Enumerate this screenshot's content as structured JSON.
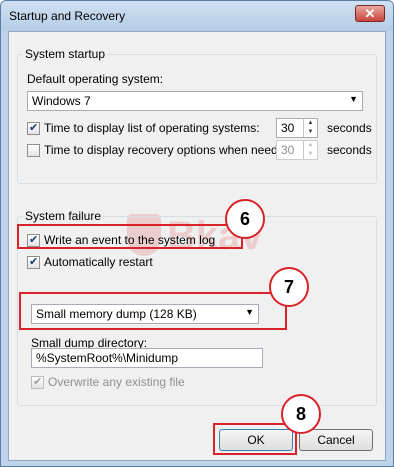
{
  "window": {
    "title": "Startup and Recovery",
    "close_label": "✕"
  },
  "system_startup": {
    "legend": "System startup",
    "default_os_label": "Default operating system:",
    "default_os_value": "Windows 7",
    "time_list": {
      "label": "Time to display list of operating systems:",
      "checked": true,
      "value": "30",
      "unit": "seconds"
    },
    "time_recovery": {
      "label": "Time to display recovery options when needed:",
      "checked": false,
      "value": "30",
      "unit": "seconds"
    }
  },
  "system_failure": {
    "legend": "System failure",
    "write_event": {
      "label": "Write an event to the system log",
      "checked": true
    },
    "auto_restart": {
      "label": "Automatically restart",
      "checked": true
    },
    "debug_info_value": "Small memory dump (128 KB)",
    "dump_dir_label": "Small dump directory:",
    "dump_dir_value": "%SystemRoot%\\Minidump",
    "overwrite": {
      "label": "Overwrite any existing file",
      "checked": true
    }
  },
  "buttons": {
    "ok": "OK",
    "cancel": "Cancel"
  },
  "annotations": {
    "step6": "6",
    "step7": "7",
    "step8": "8",
    "watermark": "Bkav"
  },
  "colors": {
    "annotation": "#d9232a",
    "titlebar": "#bcd3ea"
  }
}
